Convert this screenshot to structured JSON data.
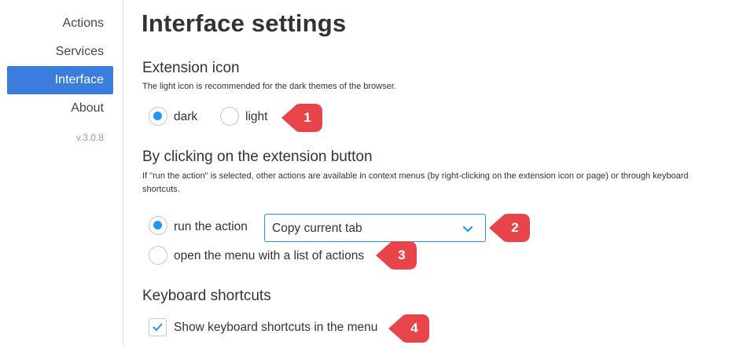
{
  "sidebar": {
    "items": [
      {
        "label": "Actions",
        "active": false
      },
      {
        "label": "Services",
        "active": false
      },
      {
        "label": "Interface",
        "active": true
      },
      {
        "label": "About",
        "active": false
      }
    ],
    "version": "v.3.0.8"
  },
  "main": {
    "title": "Interface settings",
    "extension_icon": {
      "title": "Extension icon",
      "description": "The light icon is recommended for the dark themes of the browser.",
      "options": [
        {
          "label": "dark",
          "checked": true
        },
        {
          "label": "light",
          "checked": false
        }
      ]
    },
    "click_behavior": {
      "title": "By clicking on the extension button",
      "description_line1": "If \"run the action\" is selected, other actions are available in context menus (by right-clicking on the extension icon or page) or through keyboard",
      "description_line2": "shortcuts.",
      "run_action_label": "run the action",
      "run_action_checked": true,
      "selected_action": "Copy current tab",
      "open_menu_label": "open the menu with a list of actions",
      "open_menu_checked": false
    },
    "keyboard": {
      "title": "Keyboard shortcuts",
      "checkbox_label": "Show keyboard shortcuts in the menu",
      "checked": true
    }
  },
  "callouts": [
    "1",
    "2",
    "3",
    "4"
  ],
  "colors": {
    "accent": "#2196f3",
    "nav_active": "#3b7ddd",
    "callout": "#e8454a"
  },
  "icons": {
    "select_indicator": "chevron-down-icon",
    "checkbox_mark": "checkmark-icon",
    "callout_marker": "arrow-callout-icon"
  }
}
